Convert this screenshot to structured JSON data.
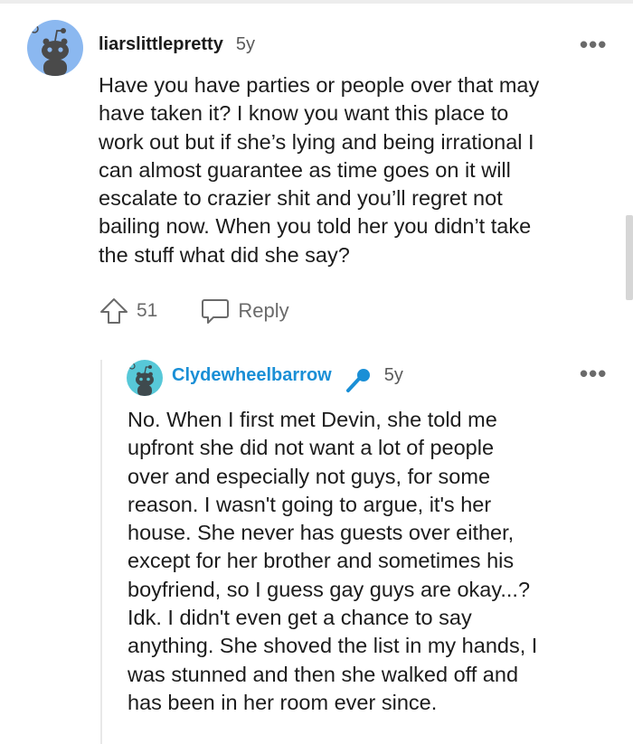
{
  "parent_comment": {
    "avatar_icon": "snoo-avatar-icon",
    "avatar_color": "#8bb8f0",
    "username": "liarslittlepretty",
    "age": "5y",
    "more_icon": "•••",
    "body": "Have you have parties or people over that may\nhave taken it? I know you want this place to\nwork out but if she’s lying and being irrational I\ncan almost guarantee as time goes on it will\nescalate to crazier shit and you’ll regret not\nbailing now. When you told her you didn’t take\nthe stuff what did she say?",
    "upvote_icon": "upvote-arrow-icon",
    "upvote_count": "51",
    "reply_icon": "speech-bubble-icon",
    "reply_label": "Reply"
  },
  "reply_comment": {
    "avatar_icon": "snoo-avatar-icon",
    "avatar_color": "#57c8d8",
    "username": "Clydewheelbarrow",
    "username_color": "#1a8fd6",
    "badge_icon": "microphone-icon",
    "age": "5y",
    "more_icon": "•••",
    "body": "No. When I first met Devin, she told me\nupfront she did not want a lot of people\nover and especially not guys, for some\nreason. I wasn't going to argue, it's her\nhouse. She never has guests over either,\nexcept for her brother and sometimes his\nboyfriend, so I guess gay guys are okay...?\nIdk. I didn't even get a chance to say\nanything. She shoved the list in my hands, I\nwas stunned and then she walked off and\nhas been in her room ever since."
  }
}
